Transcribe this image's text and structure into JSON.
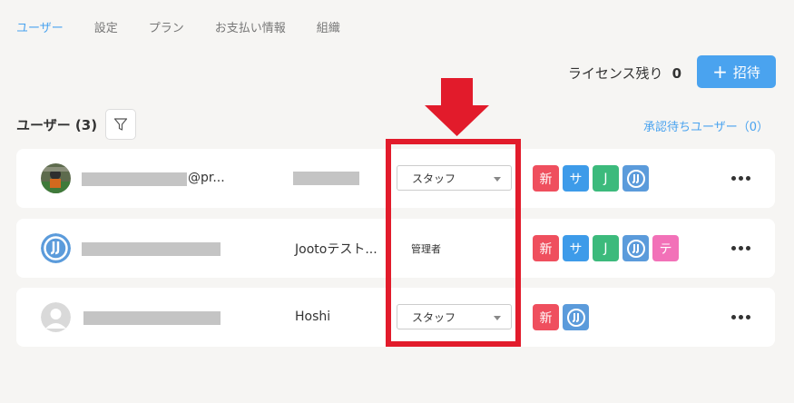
{
  "tabs": [
    {
      "label": "ユーザー",
      "active": true
    },
    {
      "label": "設定"
    },
    {
      "label": "プラン"
    },
    {
      "label": "お支払い情報"
    },
    {
      "label": "組織"
    }
  ],
  "license": {
    "label": "ライセンス残り",
    "count": "0"
  },
  "invite_button": {
    "icon": "plus-icon",
    "label": "招待"
  },
  "users_heading": "ユーザー (3)",
  "pending_link": "承認待ちユーザー（0）",
  "users": [
    {
      "email_suffix": "@pr...",
      "name": "",
      "role": "スタッフ",
      "role_editable": true,
      "tags": [
        {
          "text": "新",
          "color": "#ef4f5e"
        },
        {
          "text": "サ",
          "color": "#3d9be9"
        },
        {
          "text": "J",
          "color": "#3cba7c"
        },
        {
          "text": "",
          "color": "#5b9bdb",
          "icon": "jooto-logo-icon"
        }
      ]
    },
    {
      "email_suffix": "",
      "name": "Jootoテスト...",
      "role": "管理者",
      "role_editable": false,
      "tags": [
        {
          "text": "新",
          "color": "#ef4f5e"
        },
        {
          "text": "サ",
          "color": "#3d9be9"
        },
        {
          "text": "J",
          "color": "#3cba7c"
        },
        {
          "text": "",
          "color": "#5b9bdb",
          "icon": "jooto-logo-icon"
        },
        {
          "text": "テ",
          "color": "#f271b8"
        }
      ]
    },
    {
      "email_suffix": "",
      "name": "Hoshi",
      "role": "スタッフ",
      "role_editable": true,
      "tags": [
        {
          "text": "新",
          "color": "#ef4f5e"
        },
        {
          "text": "",
          "color": "#5b9bdb",
          "icon": "jooto-logo-icon"
        }
      ]
    }
  ],
  "colors": {
    "accent": "#4aa3ef",
    "annotation": "#e21b2b"
  }
}
